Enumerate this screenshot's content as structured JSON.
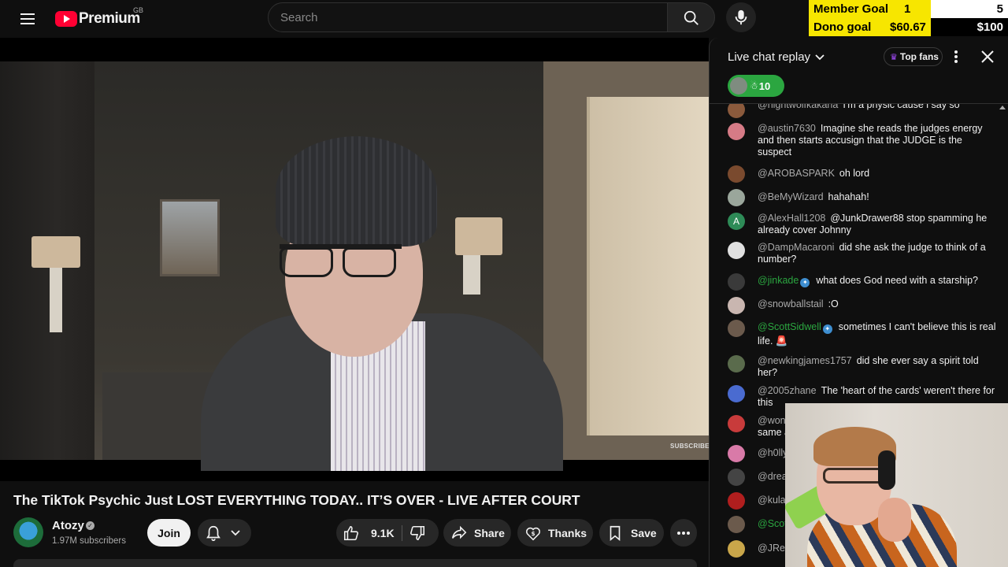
{
  "header": {
    "logo_text": "Premium",
    "region": "GB",
    "search_placeholder": "Search"
  },
  "goals": {
    "member_label": "Member Goal",
    "member_current": "1",
    "member_target": "5",
    "dono_label": "Dono goal",
    "dono_current": "$60.67",
    "dono_target": "$100",
    "accent_color": "#f7e600"
  },
  "video": {
    "watermark": "SUBSCRIBE",
    "title": "The TikTok Psychic Just LOST EVERYTHING TODAY.. IT’S OVER - LIVE AFTER COURT"
  },
  "channel": {
    "name": "Atozy",
    "subscribers": "1.97M subscribers"
  },
  "actions": {
    "join": "Join",
    "likes": "9.1K",
    "share": "Share",
    "thanks": "Thanks",
    "save": "Save"
  },
  "chat": {
    "title": "Live chat replay",
    "top_fans": "Top fans",
    "viewer_count": "10",
    "messages": [
      {
        "author": "@nightwolfkakana",
        "text": "I'm a physic cause i say so",
        "color": "#8b5a3c"
      },
      {
        "author": "@austin7630",
        "text": "Imagine she reads the judges energy and then starts accusign that the JUDGE is the suspect",
        "color": "#d67b86"
      },
      {
        "author": "@AROBASPARK",
        "text": "oh lord",
        "color": "#7a4a2e"
      },
      {
        "author": "@BeMyWizard",
        "text": "hahahah!",
        "color": "#9aa69b"
      },
      {
        "author": "@AlexHall1208",
        "text": "@JunkDrawer88 stop spamming he already cover Johnny",
        "color": "#2e8b57",
        "initial": "A"
      },
      {
        "author": "@DampMacaroni",
        "text": "did she ask the judge to think of a number?",
        "color": "#e0e0e0"
      },
      {
        "author": "@jinkade",
        "text": "what does God need with a starship?",
        "color": "#3a3a3a",
        "mod": true
      },
      {
        "author": "@snowballstail",
        "text": ":O",
        "color": "#c9b6b0"
      },
      {
        "author": "@ScottSidwell",
        "text": "sometimes I can't believe this is real life. 🚨",
        "color": "#6b5a4c",
        "mod": true
      },
      {
        "author": "@newkingjames1757",
        "text": "did she ever say a spirit told her?",
        "color": "#5a6b4c"
      },
      {
        "author": "@2005zhane",
        "text": "The 'heart of the cards' weren't there for this",
        "color": "#4a6bd0"
      },
      {
        "author": "@wont",
        "text": "same a",
        "color": "#c83b3b"
      },
      {
        "author": "@h0lly",
        "text": "",
        "color": "#d97aa8"
      },
      {
        "author": "@drea",
        "text": "",
        "color": "#444444"
      },
      {
        "author": "@kulal",
        "text": "",
        "color": "#b01e1e"
      },
      {
        "author": "@Scot",
        "text": "",
        "color": "#6b5a4c",
        "mod": true
      },
      {
        "author": "@JRe",
        "text": "",
        "color": "#c9a64a"
      }
    ]
  }
}
